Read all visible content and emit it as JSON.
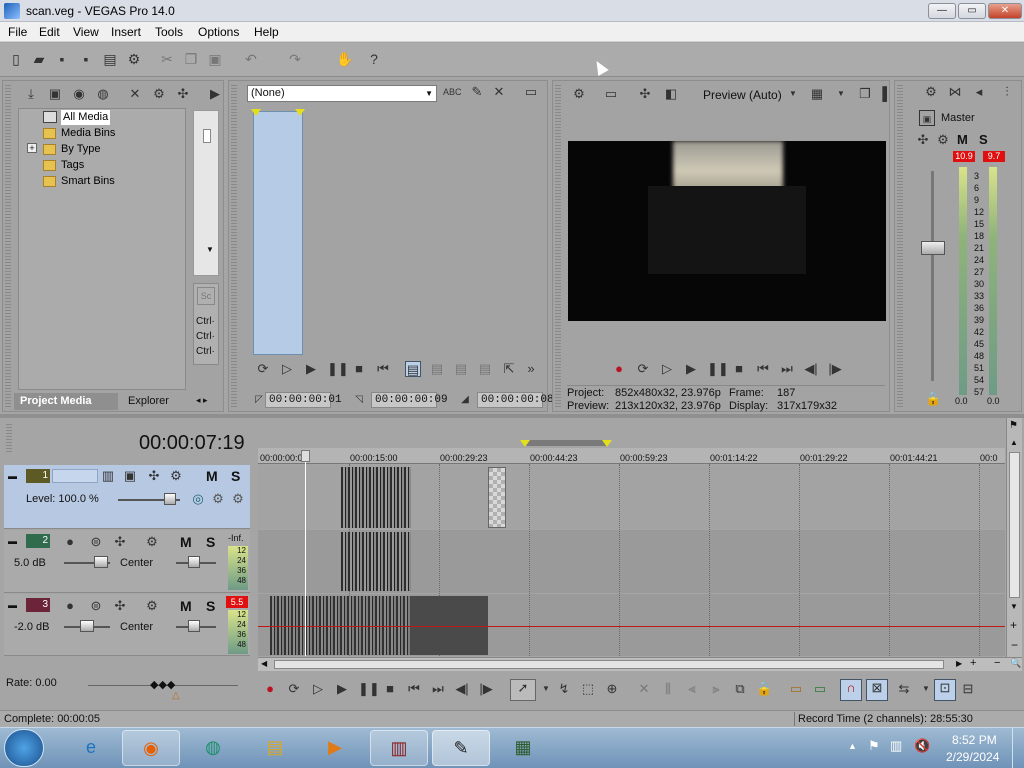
{
  "app": {
    "title": "scan.veg - VEGAS Pro 14.0"
  },
  "window_buttons": {
    "min": "—",
    "max": "▭",
    "close": "✕"
  },
  "menu": [
    "File",
    "Edit",
    "View",
    "Insert",
    "Tools",
    "Options",
    "Help"
  ],
  "media_panel": {
    "tree": [
      "All Media",
      "Media Bins",
      "By Type",
      "Tags",
      "Smart Bins"
    ],
    "expand": "+",
    "tabs": [
      "Project Media",
      "Explorer"
    ],
    "ctrl_labels": [
      "Ctrl·",
      "Ctrl·",
      "Ctrl·"
    ]
  },
  "trimmer": {
    "dropdown": "(None)",
    "tc_in": "00:00:00:01",
    "tc_out": "00:00:00:09",
    "tc_len": "00:00:00:08"
  },
  "preview": {
    "mode": "Preview (Auto)",
    "project_label": "Project:",
    "project_value": "852x480x32, 23.976p",
    "preview_label": "Preview:",
    "preview_value": "213x120x32, 23.976p",
    "frame_label": "Frame:",
    "frame_value": "187",
    "display_label": "Display:",
    "display_value": "317x179x32"
  },
  "master": {
    "label": "Master",
    "peak_left": "10.9",
    "peak_right": "9.7",
    "scale": [
      "3",
      "6",
      "9",
      "12",
      "15",
      "18",
      "21",
      "24",
      "27",
      "30",
      "33",
      "36",
      "39",
      "42",
      "45",
      "48",
      "51",
      "54",
      "57"
    ],
    "bottom_left": "0.0",
    "bottom_right": "0.0",
    "m": "M",
    "s": "S"
  },
  "timeline": {
    "cursor_time": "00:00:07:19",
    "ruler": [
      "00:00:00:00",
      "00:00:15:00",
      "00:00:29:23",
      "00:00:44:23",
      "00:00:59:23",
      "00:01:14:22",
      "00:01:29:22",
      "00:01:44:21",
      "00:0"
    ],
    "tracks": [
      {
        "num": "1",
        "level": "Level: 100.0 %",
        "m": "M",
        "s": "S"
      },
      {
        "num": "2",
        "vol": "5.0 dB",
        "pan": "Center",
        "peak": "-Inf.",
        "m": "M",
        "s": "S",
        "mini": [
          "12",
          "24",
          "36",
          "48"
        ]
      },
      {
        "num": "3",
        "vol": "-2.0 dB",
        "pan": "Center",
        "peak": "5.5",
        "m": "M",
        "s": "S",
        "mini": [
          "12",
          "24",
          "36",
          "48"
        ]
      }
    ],
    "rate": "Rate: 0.00"
  },
  "status": {
    "complete": "Complete: 00:00:05",
    "record_time": "Record Time (2 channels): 28:55:30"
  },
  "taskbar": {
    "time": "8:52 PM",
    "date": "2/29/2024"
  },
  "colors": {
    "accent_selected": "#b7c8e2",
    "peak_red": "#e01010"
  }
}
